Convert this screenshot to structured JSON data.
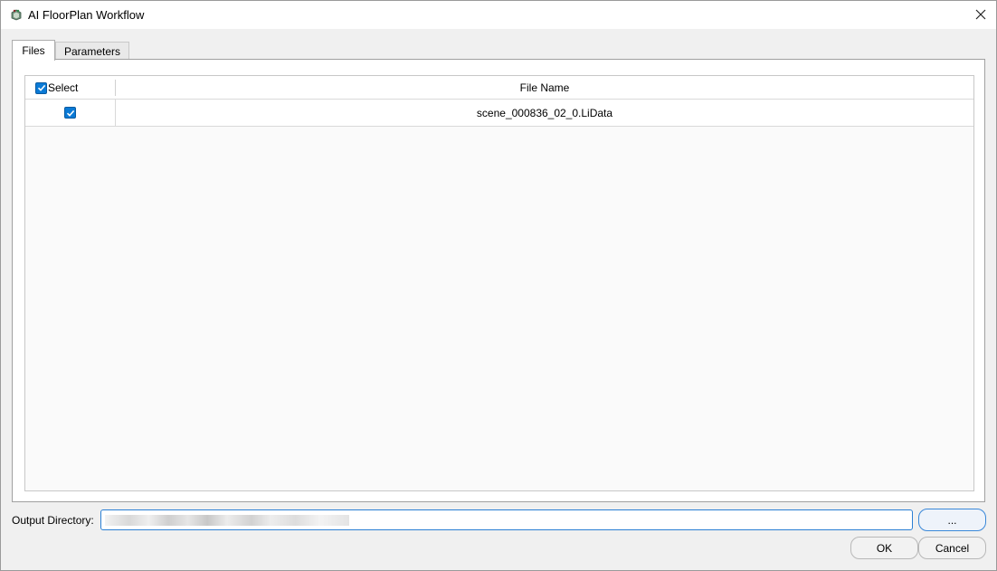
{
  "window": {
    "title": "AI FloorPlan Workflow"
  },
  "tabs": [
    {
      "label": "Files",
      "active": true
    },
    {
      "label": "Parameters",
      "active": false
    }
  ],
  "table": {
    "columns": {
      "select": "Select",
      "file_name": "File Name"
    },
    "header_checked": true,
    "rows": [
      {
        "checked": true,
        "file_name": "scene_000836_02_0.LiData"
      }
    ]
  },
  "output": {
    "label": "Output Directory:",
    "value": "",
    "browse_label": "..."
  },
  "buttons": {
    "ok": "OK",
    "cancel": "Cancel"
  },
  "colors": {
    "accent": "#0a7ad6",
    "focus_border": "#2a7fd4"
  }
}
